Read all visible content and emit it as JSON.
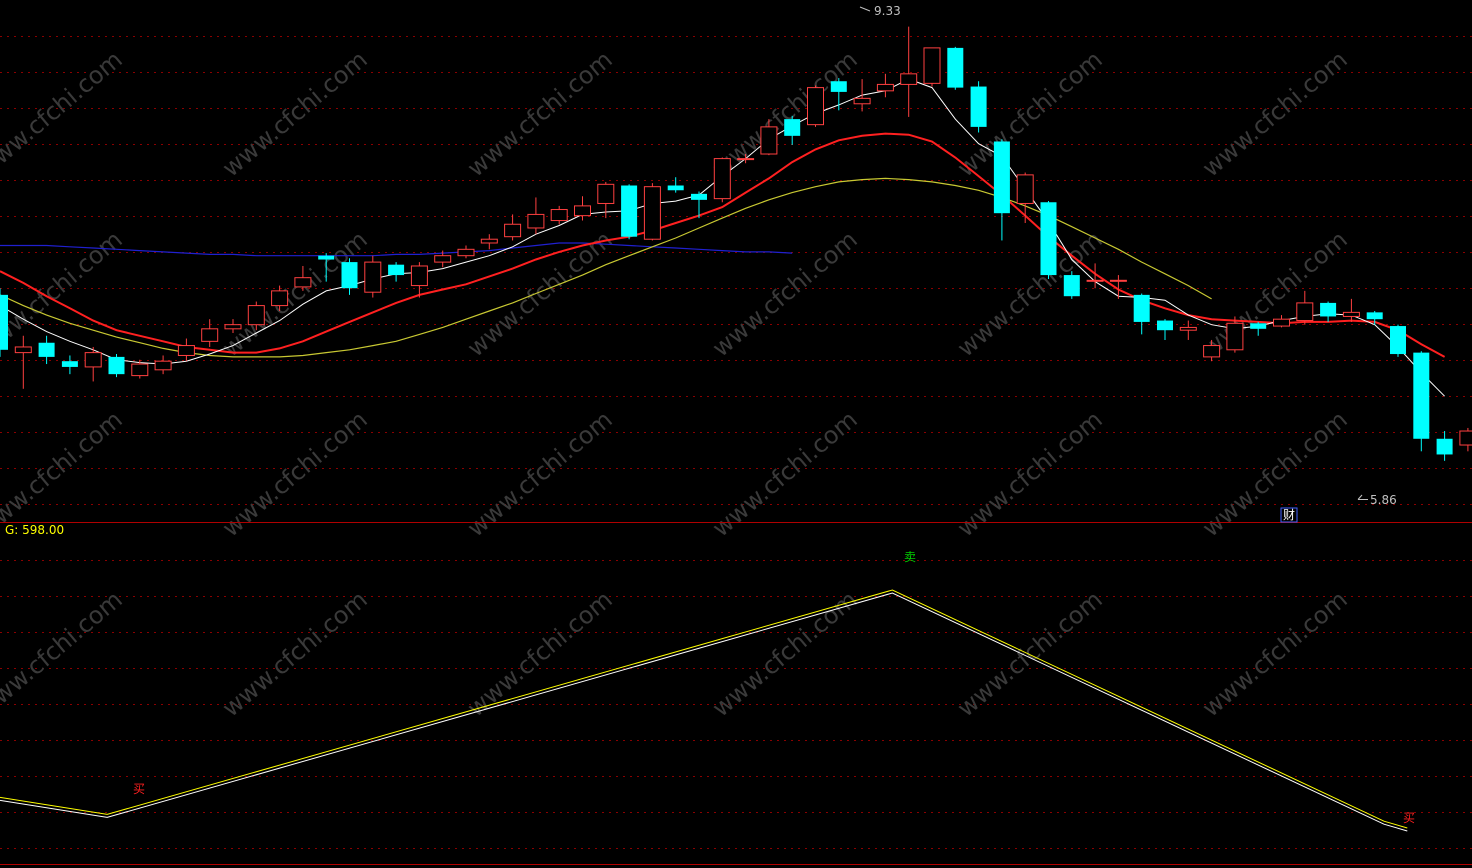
{
  "indicator": {
    "label": "G: 598.00"
  },
  "markers": {
    "high": "9.33",
    "low": "5.86",
    "finance": "财",
    "buy": "买",
    "sell": "卖"
  },
  "watermark": "www.cfchi.com",
  "colors": {
    "bg": "#000000",
    "up": "#ff4040",
    "down": "#00ffff",
    "ma_white": "#ffffff",
    "ma_red": "#ff2020",
    "ma_yellow": "#c8c832",
    "ma_blue": "#2020d0",
    "grid": "#8a0000",
    "divider": "#b00000",
    "label_yellow": "#ffff00",
    "sell_green": "#00d000",
    "buy_red": "#ff2020"
  },
  "chart_data": [
    {
      "type": "candlestick",
      "yscale": "log",
      "yrange": [
        5.5,
        9.6
      ],
      "candles": [
        {
          "o": 7.0,
          "c": 6.6,
          "h": 7.05,
          "l": 6.55
        },
        {
          "o": 6.58,
          "c": 6.62,
          "h": 6.7,
          "l": 6.33
        },
        {
          "o": 6.65,
          "c": 6.55,
          "h": 6.7,
          "l": 6.5
        },
        {
          "o": 6.52,
          "c": 6.48,
          "h": 6.56,
          "l": 6.43
        },
        {
          "o": 6.48,
          "c": 6.58,
          "h": 6.62,
          "l": 6.38
        },
        {
          "o": 6.55,
          "c": 6.43,
          "h": 6.57,
          "l": 6.41
        },
        {
          "o": 6.42,
          "c": 6.5,
          "h": 6.53,
          "l": 6.4
        },
        {
          "o": 6.46,
          "c": 6.52,
          "h": 6.56,
          "l": 6.43
        },
        {
          "o": 6.56,
          "c": 6.63,
          "h": 6.68,
          "l": 6.52
        },
        {
          "o": 6.66,
          "c": 6.75,
          "h": 6.82,
          "l": 6.62
        },
        {
          "o": 6.75,
          "c": 6.78,
          "h": 6.82,
          "l": 6.72
        },
        {
          "o": 6.78,
          "c": 6.92,
          "h": 6.95,
          "l": 6.74
        },
        {
          "o": 6.92,
          "c": 7.03,
          "h": 7.07,
          "l": 6.88
        },
        {
          "o": 7.06,
          "c": 7.13,
          "h": 7.22,
          "l": 7.03
        },
        {
          "o": 7.3,
          "c": 7.27,
          "h": 7.32,
          "l": 7.1
        },
        {
          "o": 7.25,
          "c": 7.05,
          "h": 7.28,
          "l": 7.0
        },
        {
          "o": 7.02,
          "c": 7.25,
          "h": 7.3,
          "l": 6.98
        },
        {
          "o": 7.23,
          "c": 7.15,
          "h": 7.25,
          "l": 7.1
        },
        {
          "o": 7.07,
          "c": 7.22,
          "h": 7.25,
          "l": 6.98
        },
        {
          "o": 7.25,
          "c": 7.3,
          "h": 7.34,
          "l": 7.21
        },
        {
          "o": 7.3,
          "c": 7.35,
          "h": 7.38,
          "l": 7.28
        },
        {
          "o": 7.4,
          "c": 7.43,
          "h": 7.47,
          "l": 7.35
        },
        {
          "o": 7.45,
          "c": 7.55,
          "h": 7.63,
          "l": 7.42
        },
        {
          "o": 7.52,
          "c": 7.63,
          "h": 7.77,
          "l": 7.47
        },
        {
          "o": 7.58,
          "c": 7.67,
          "h": 7.7,
          "l": 7.55
        },
        {
          "o": 7.62,
          "c": 7.7,
          "h": 7.78,
          "l": 7.58
        },
        {
          "o": 7.72,
          "c": 7.88,
          "h": 7.9,
          "l": 7.6
        },
        {
          "o": 7.87,
          "c": 7.45,
          "h": 7.88,
          "l": 7.43
        },
        {
          "o": 7.43,
          "c": 7.86,
          "h": 7.89,
          "l": 7.42
        },
        {
          "o": 7.87,
          "c": 7.83,
          "h": 7.94,
          "l": 7.81
        },
        {
          "o": 7.8,
          "c": 7.75,
          "h": 7.82,
          "l": 7.6
        },
        {
          "o": 7.76,
          "c": 8.1,
          "h": 8.11,
          "l": 7.73
        },
        {
          "o": 8.1,
          "c": 8.1,
          "h": 8.14,
          "l": 8.06
        },
        {
          "o": 8.14,
          "c": 8.38,
          "h": 8.45,
          "l": 8.13
        },
        {
          "o": 8.45,
          "c": 8.3,
          "h": 8.48,
          "l": 8.22
        },
        {
          "o": 8.4,
          "c": 8.74,
          "h": 8.76,
          "l": 8.38
        },
        {
          "o": 8.8,
          "c": 8.7,
          "h": 8.83,
          "l": 8.53
        },
        {
          "o": 8.59,
          "c": 8.64,
          "h": 8.82,
          "l": 8.52
        },
        {
          "o": 8.71,
          "c": 8.77,
          "h": 8.87,
          "l": 8.65
        },
        {
          "o": 8.77,
          "c": 8.87,
          "h": 9.33,
          "l": 8.47
        },
        {
          "o": 8.78,
          "c": 9.12,
          "h": 9.12,
          "l": 8.75
        },
        {
          "o": 9.12,
          "c": 8.74,
          "h": 9.13,
          "l": 8.72
        },
        {
          "o": 8.75,
          "c": 8.38,
          "h": 8.8,
          "l": 8.33
        },
        {
          "o": 8.25,
          "c": 7.64,
          "h": 8.27,
          "l": 7.42
        },
        {
          "o": 7.72,
          "c": 7.96,
          "h": 7.98,
          "l": 7.56
        },
        {
          "o": 7.73,
          "c": 7.15,
          "h": 7.74,
          "l": 7.12
        },
        {
          "o": 7.15,
          "c": 6.99,
          "h": 7.18,
          "l": 6.97
        },
        {
          "o": 7.11,
          "c": 7.11,
          "h": 7.24,
          "l": 7.05
        },
        {
          "o": 7.11,
          "c": 7.11,
          "h": 7.15,
          "l": 6.97
        },
        {
          "o": 7.0,
          "c": 6.8,
          "h": 7.01,
          "l": 6.71
        },
        {
          "o": 6.81,
          "c": 6.74,
          "h": 6.82,
          "l": 6.67
        },
        {
          "o": 6.74,
          "c": 6.76,
          "h": 6.81,
          "l": 6.67
        },
        {
          "o": 6.55,
          "c": 6.63,
          "h": 6.67,
          "l": 6.52
        },
        {
          "o": 6.6,
          "c": 6.79,
          "h": 6.84,
          "l": 6.58
        },
        {
          "o": 6.79,
          "c": 6.75,
          "h": 6.8,
          "l": 6.7
        },
        {
          "o": 6.77,
          "c": 6.82,
          "h": 6.85,
          "l": 6.76
        },
        {
          "o": 6.81,
          "c": 6.94,
          "h": 7.03,
          "l": 6.78
        },
        {
          "o": 6.94,
          "c": 6.84,
          "h": 6.95,
          "l": 6.8
        },
        {
          "o": 6.84,
          "c": 6.87,
          "h": 6.97,
          "l": 6.8
        },
        {
          "o": 6.87,
          "c": 6.82,
          "h": 6.88,
          "l": 6.78
        },
        {
          "o": 6.77,
          "c": 6.57,
          "h": 6.78,
          "l": 6.55
        },
        {
          "o": 6.58,
          "c": 6.0,
          "h": 6.59,
          "l": 5.92
        },
        {
          "o": 6.0,
          "c": 5.9,
          "h": 6.05,
          "l": 5.86
        },
        {
          "o": 5.96,
          "c": 6.05,
          "h": 6.07,
          "l": 5.92
        }
      ],
      "ma5": [
        6.92,
        6.82,
        6.73,
        6.66,
        6.6,
        6.53,
        6.51,
        6.5,
        6.52,
        6.57,
        6.63,
        6.72,
        6.81,
        6.93,
        7.03,
        7.07,
        7.12,
        7.16,
        7.17,
        7.2,
        7.25,
        7.3,
        7.37,
        7.47,
        7.54,
        7.63,
        7.65,
        7.66,
        7.72,
        7.74,
        7.79,
        7.95,
        8.1,
        8.27,
        8.39,
        8.5,
        8.58,
        8.67,
        8.71,
        8.82,
        8.74,
        8.45,
        8.23,
        8.12,
        7.84,
        7.57,
        7.27,
        7.1,
        6.99,
        6.98,
        6.96,
        6.85,
        6.78,
        6.75,
        6.77,
        6.81,
        6.84,
        6.86,
        6.85,
        6.78,
        6.62,
        6.44,
        6.28
      ],
      "ma10": [
        7.18,
        7.09,
        6.99,
        6.9,
        6.81,
        6.74,
        6.7,
        6.66,
        6.62,
        6.6,
        6.58,
        6.58,
        6.61,
        6.66,
        6.73,
        6.8,
        6.87,
        6.94,
        7.0,
        7.04,
        7.08,
        7.14,
        7.2,
        7.27,
        7.33,
        7.38,
        7.42,
        7.45,
        7.5,
        7.56,
        7.62,
        7.69,
        7.81,
        7.93,
        8.07,
        8.18,
        8.26,
        8.3,
        8.32,
        8.31,
        8.25,
        8.11,
        7.95,
        7.79,
        7.62,
        7.45,
        7.3,
        7.16,
        7.04,
        6.96,
        6.9,
        6.85,
        6.82,
        6.81,
        6.8,
        6.79,
        6.8,
        6.8,
        6.81,
        6.8,
        6.74,
        6.64,
        6.55
      ],
      "ma30": [
        7.0,
        6.92,
        6.85,
        6.79,
        6.74,
        6.69,
        6.65,
        6.61,
        6.58,
        6.56,
        6.55,
        6.55,
        6.55,
        6.56,
        6.58,
        6.6,
        6.63,
        6.66,
        6.71,
        6.76,
        6.82,
        6.88,
        6.94,
        7.01,
        7.08,
        7.15,
        7.23,
        7.3,
        7.37,
        7.44,
        7.52,
        7.6,
        7.68,
        7.75,
        7.81,
        7.86,
        7.9,
        7.92,
        7.93,
        7.92,
        7.9,
        7.87,
        7.83,
        7.77,
        7.7,
        7.62,
        7.53,
        7.44,
        7.35,
        7.25,
        7.16,
        7.07,
        6.97
      ],
      "ma_blue": [
        7.38,
        7.38,
        7.38,
        7.37,
        7.36,
        7.35,
        7.34,
        7.33,
        7.32,
        7.31,
        7.31,
        7.3,
        7.3,
        7.3,
        7.3,
        7.3,
        7.3,
        7.31,
        7.31,
        7.32,
        7.33,
        7.34,
        7.36,
        7.38,
        7.4,
        7.4,
        7.39,
        7.38,
        7.37,
        7.36,
        7.35,
        7.34,
        7.33,
        7.33,
        7.32
      ]
    },
    {
      "type": "line",
      "points": [
        [
          0,
          0.81
        ],
        [
          4.6,
          0.86
        ],
        [
          38.3,
          0.2
        ],
        [
          59.4,
          0.88
        ],
        [
          60.4,
          0.9
        ]
      ],
      "signals": [
        {
          "type": "buy",
          "x": 5.7
        },
        {
          "type": "sell",
          "x": 37.3
        },
        {
          "type": "buy",
          "x": 59.8
        }
      ]
    }
  ]
}
